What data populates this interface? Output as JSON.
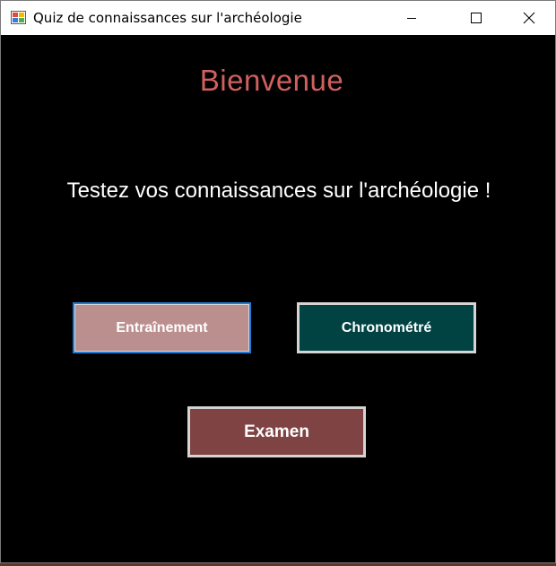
{
  "window": {
    "title": "Quiz de connaissances sur l'archéologie",
    "controls": [
      "minimize-icon",
      "maximize-icon",
      "close-icon"
    ]
  },
  "main": {
    "heading": "Bienvenue",
    "subtitle": "Testez vos connaissances sur l'archéologie !",
    "buttons": {
      "training": "Entraînement",
      "timed": "Chronométré",
      "exam": "Examen"
    }
  },
  "colors": {
    "background": "#000000",
    "heading": "#d0605e",
    "training_button": "#bc8f8f",
    "training_focus_border": "#1e7bd6",
    "timed_button": "#014343",
    "exam_button": "#804343"
  }
}
